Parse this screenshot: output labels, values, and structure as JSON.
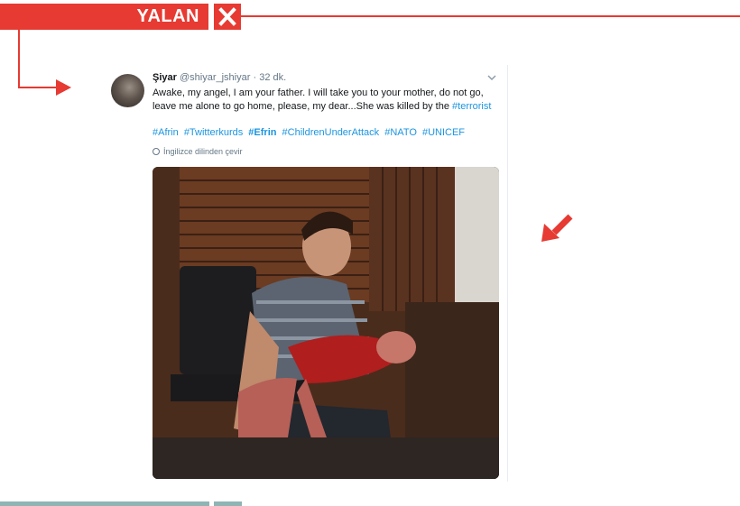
{
  "verdict": {
    "label": "YALAN",
    "close_icon": "close-icon"
  },
  "colors": {
    "accent": "#e63a32",
    "link": "#1b95e0",
    "muted": "#657786"
  },
  "tweet": {
    "display_name": "Şiyar",
    "handle": "@shiyar_jshiyar",
    "separator": "·",
    "time": "32 dk.",
    "text": "Awake, my angel, I am your father. I will take you to your mother, do not go, leave me alone to go home, please, my dear...She was killed by the",
    "text_link": "#terrorist",
    "hashtags": [
      {
        "text": "#Afrin"
      },
      {
        "text": "#Twitterkurds"
      },
      {
        "text": "#Efrin"
      },
      {
        "text": "#ChildrenUnderAttack"
      },
      {
        "text": "#NATO"
      },
      {
        "text": "#UNICEF"
      }
    ],
    "translate": "İngilizce dilinden çevir",
    "menu_icon": "chevron-down-icon",
    "avatar_icon": "avatar",
    "photo": "tweet-photo"
  }
}
